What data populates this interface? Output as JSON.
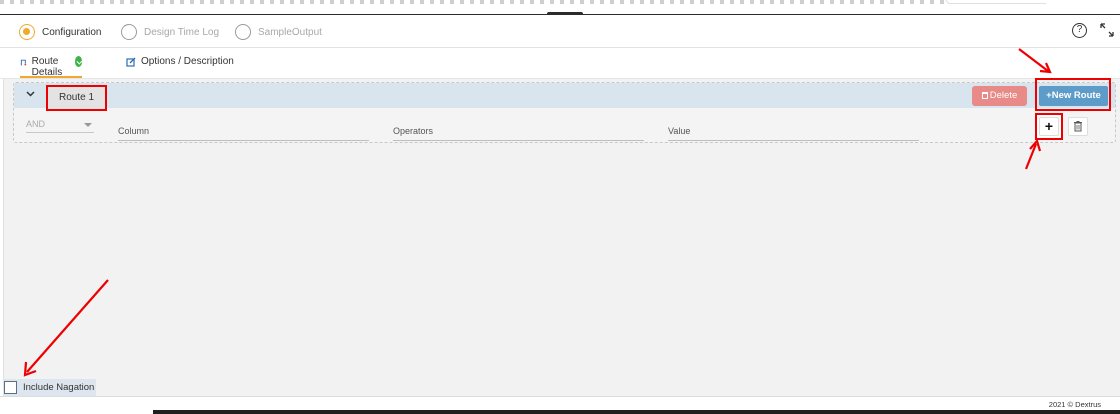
{
  "steps": [
    {
      "label": "Configuration",
      "active": true
    },
    {
      "label": "Design Time Log",
      "active": false
    },
    {
      "label": "SampleOutput",
      "active": false
    }
  ],
  "tabs": [
    {
      "label": "Route Details",
      "active": true
    },
    {
      "label": "Options / Description",
      "active": false
    }
  ],
  "route": {
    "name": "Route 1",
    "delete_label": "Delete",
    "new_route_label": "New Route",
    "condition": {
      "logic_value": "AND",
      "column_placeholder": "Column",
      "operators_placeholder": "Operators",
      "value_placeholder": "Value"
    }
  },
  "negation": {
    "label": "Include Nagation",
    "checked": false
  },
  "footer": {
    "copyright": "2021 © Dextrus"
  },
  "colors": {
    "accent": "#f0a830",
    "new_route": "#5d9bc8",
    "delete": "#e88a87",
    "annotation": "#ee0000"
  }
}
